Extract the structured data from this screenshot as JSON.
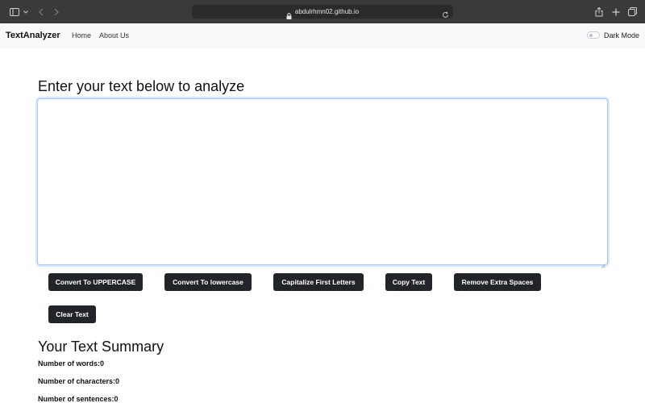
{
  "browser": {
    "url": "abdulrhmn02.github.io",
    "icons": [
      "sidebar-icon",
      "chevron-down-icon",
      "back-icon",
      "forward-icon",
      "lock-icon",
      "reload-icon",
      "share-icon",
      "new-tab-icon",
      "tabs-icon"
    ]
  },
  "navbar": {
    "brand": "TextAnalyzer",
    "links": [
      "Home",
      "About Us"
    ],
    "dark_mode_label": "Dark Mode"
  },
  "main": {
    "heading": "Enter your text below to analyze",
    "textarea_value": "",
    "buttons": [
      "Convert To UPPERCASE",
      "Convert To lowercase",
      "Capitalize First Letters",
      "Copy Text",
      "Remove Extra Spaces",
      "Clear Text"
    ]
  },
  "summary": {
    "title": "Your Text Summary",
    "words": "Number of words:0",
    "characters": "Number of characters:0",
    "sentences": "Number of sentences:0"
  },
  "colors": {
    "button_bg": "#212529",
    "navbar_bg": "#f8f9fa",
    "focus_border": "#aac6ee"
  }
}
